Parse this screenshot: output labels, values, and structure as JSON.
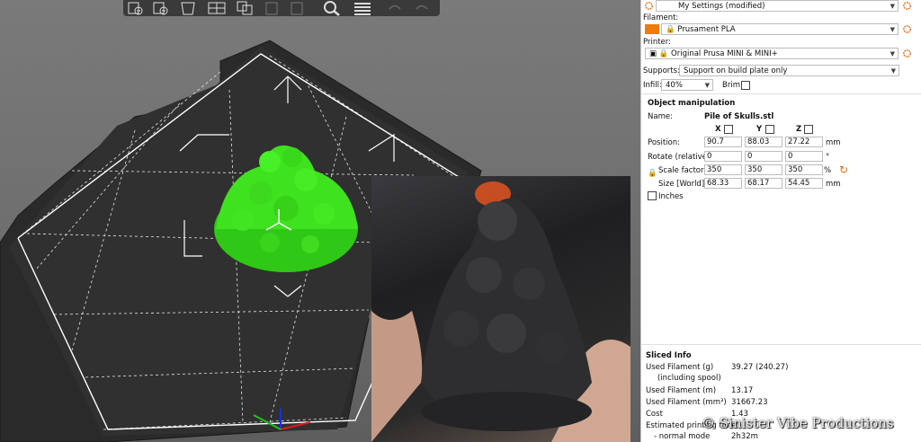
{
  "panel": {
    "print_settings": "My Settings (modified)",
    "filament_label": "Filament:",
    "filament_value": "Prusament PLA",
    "filament_color": "#f07a0a",
    "printer_label": "Printer:",
    "printer_value": "Original Prusa MINI & MINI+",
    "supports_label": "Supports:",
    "supports_value": "Support on build plate only",
    "infill_label": "Infill:",
    "infill_value": "40%",
    "brim_label": "Brim:"
  },
  "object": {
    "section_title": "Object manipulation",
    "name_label": "Name:",
    "name_value": "Pile of Skulls.stl",
    "axis_x": "X",
    "axis_y": "Y",
    "axis_z": "Z",
    "position_label": "Position:",
    "position": [
      "90.7",
      "88.03",
      "27.22"
    ],
    "position_unit": "mm",
    "rotate_label": "Rotate (relative):",
    "rotate": [
      "0",
      "0",
      "0"
    ],
    "rotate_unit": "°",
    "scale_label": "Scale factors:",
    "scale": [
      "350",
      "350",
      "350"
    ],
    "scale_unit": "%",
    "size_label": "Size [World]:",
    "size": [
      "68.33",
      "68.17",
      "54.45"
    ],
    "size_unit": "mm",
    "inches_label": "Inches"
  },
  "sliced": {
    "title": "Sliced Info",
    "rows": [
      {
        "label": "Used Filament (g)",
        "value": "39.27 (240.27)"
      },
      {
        "label": "(including spool)",
        "value": ""
      },
      {
        "label": "Used Filament (m)",
        "value": "13.17"
      },
      {
        "label": "Used Filament (mm³)",
        "value": "31667.23"
      },
      {
        "label": "Cost",
        "value": "1.43"
      },
      {
        "label": "Estimated printing time:",
        "value": ""
      },
      {
        "label": "- normal mode",
        "value": "2h32m"
      }
    ]
  },
  "watermark": "© Sinister Vibe Productions",
  "colors": {
    "model_green": "#39e01c",
    "bed": "#2b2b2b",
    "accent_orange": "#e8660c"
  }
}
